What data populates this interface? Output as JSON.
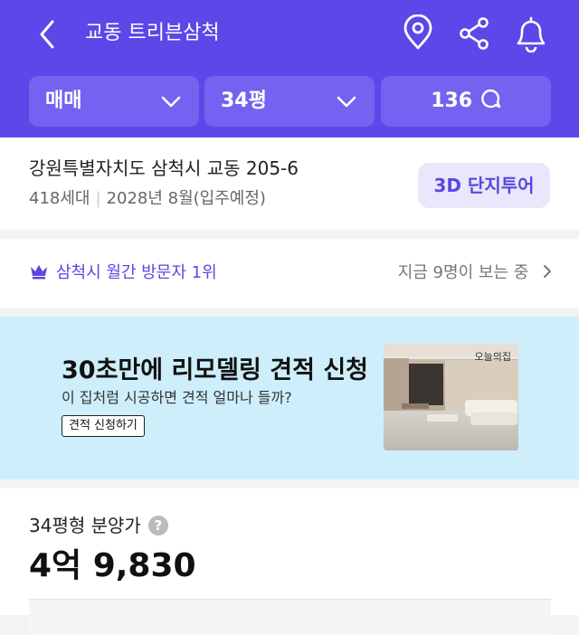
{
  "header": {
    "title": "교동 트리븐삼척",
    "icons": [
      "back-icon",
      "location-pin-icon",
      "share-icon",
      "bell-icon"
    ],
    "bg_color": "#5c48e8"
  },
  "filters": {
    "trade_type": "매매",
    "area": "34평",
    "comment_count": "136"
  },
  "complex_info": {
    "address": "강원특별자치도 삼척시 교동 205-6",
    "households": "418세대",
    "move_in": "2028년 8월(입주예정)",
    "tour_button": "3D 단지투어"
  },
  "visitors": {
    "rank_text": "삼척시 월간 방문자 1위",
    "watching_text": "지금 9명이 보는 중"
  },
  "banner": {
    "title": "30초만에 리모델링 견적 신청",
    "subtitle": "이 집처럼 시공하면 견적 얼마나 들까?",
    "button": "견적 신청하기",
    "brand": "오늘의집",
    "bg_color": "#cdeefa"
  },
  "price": {
    "label": "34평형 분양가",
    "help": "?",
    "value": "4억 9,830"
  }
}
